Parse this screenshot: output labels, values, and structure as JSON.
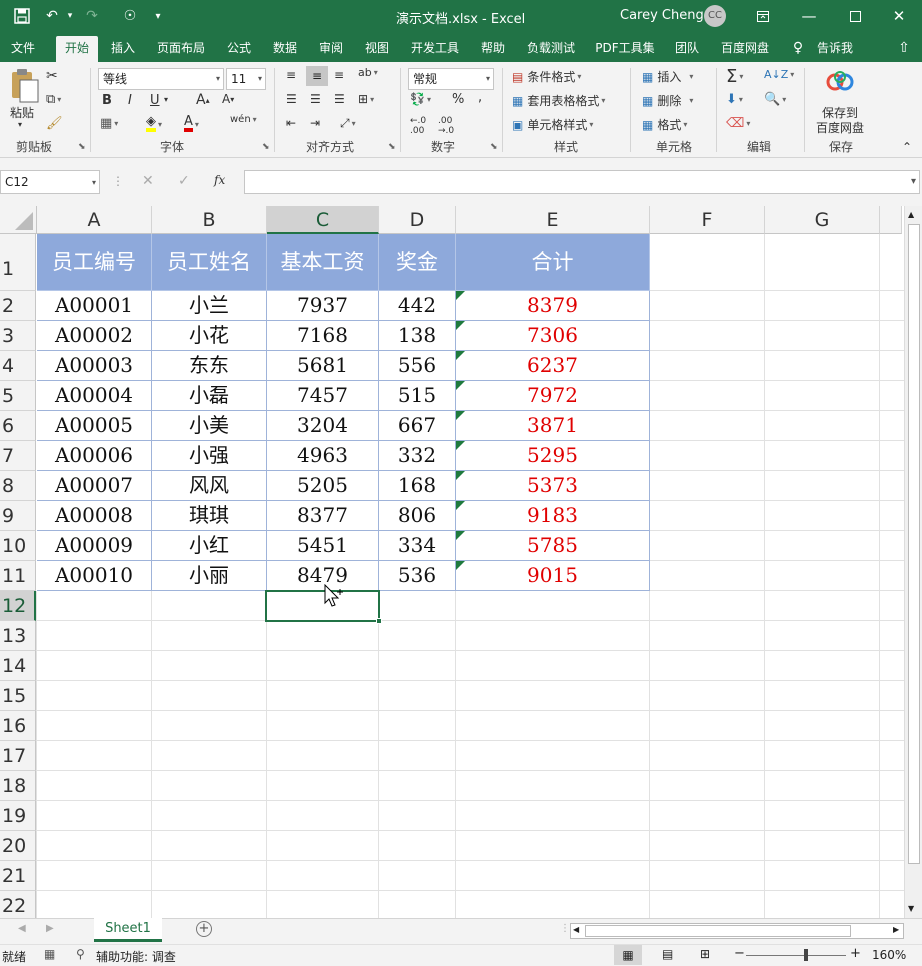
{
  "window": {
    "title": "演示文档.xlsx  -  Excel",
    "user": "Carey Cheng",
    "avatar_initials": "CC"
  },
  "ribbon_tabs": [
    "文件",
    "开始",
    "插入",
    "页面布局",
    "公式",
    "数据",
    "审阅",
    "视图",
    "开发工具",
    "帮助",
    "负载测试",
    "PDF工具集",
    "团队",
    "百度网盘",
    "告诉我"
  ],
  "ribbon": {
    "clipboard": {
      "paste": "粘贴",
      "label": "剪贴板"
    },
    "font": {
      "name": "等线",
      "size": "11",
      "label": "字体",
      "bold": "B",
      "italic": "I",
      "underline": "U"
    },
    "alignment": {
      "label": "对齐方式"
    },
    "number": {
      "format": "常规",
      "label": "数字",
      "percent": "%"
    },
    "styles": {
      "conditional": "条件格式",
      "table": "套用表格格式",
      "cell": "单元格样式",
      "label": "样式"
    },
    "cells": {
      "insert": "插入",
      "delete": "删除",
      "format": "格式",
      "label": "单元格"
    },
    "editing": {
      "label": "编辑"
    },
    "save": {
      "button_line1": "保存到",
      "button_line2": "百度网盘",
      "label": "保存"
    }
  },
  "formula_bar": {
    "name_box": "C12",
    "fx": "fx",
    "content": ""
  },
  "columns": [
    "A",
    "B",
    "C",
    "D",
    "E",
    "F",
    "G"
  ],
  "rows": [
    "1",
    "2",
    "3",
    "4",
    "5",
    "6",
    "7",
    "8",
    "9",
    "10",
    "11",
    "12",
    "13",
    "14",
    "15",
    "16",
    "17",
    "18",
    "19",
    "20",
    "21",
    "22"
  ],
  "table": {
    "headers": [
      "员工编号",
      "员工姓名",
      "基本工资",
      "奖金",
      "合计"
    ],
    "rows": [
      [
        "A00001",
        "小兰",
        "7937",
        "442",
        "8379"
      ],
      [
        "A00002",
        "小花",
        "7168",
        "138",
        "7306"
      ],
      [
        "A00003",
        "东东",
        "5681",
        "556",
        "6237"
      ],
      [
        "A00004",
        "小磊",
        "7457",
        "515",
        "7972"
      ],
      [
        "A00005",
        "小美",
        "3204",
        "667",
        "3871"
      ],
      [
        "A00006",
        "小强",
        "4963",
        "332",
        "5295"
      ],
      [
        "A00007",
        "风风",
        "5205",
        "168",
        "5373"
      ],
      [
        "A00008",
        "琪琪",
        "8377",
        "806",
        "9183"
      ],
      [
        "A00009",
        "小红",
        "5451",
        "334",
        "5785"
      ],
      [
        "A00010",
        "小丽",
        "8479",
        "536",
        "9015"
      ]
    ]
  },
  "sheet_tab": "Sheet1",
  "status": {
    "ready": "就绪",
    "accessibility": "辅助功能: 调查",
    "zoom": "160%"
  },
  "colors": {
    "accent": "#217346",
    "header_fill": "#8ea9db",
    "total_text": "#e00000"
  }
}
